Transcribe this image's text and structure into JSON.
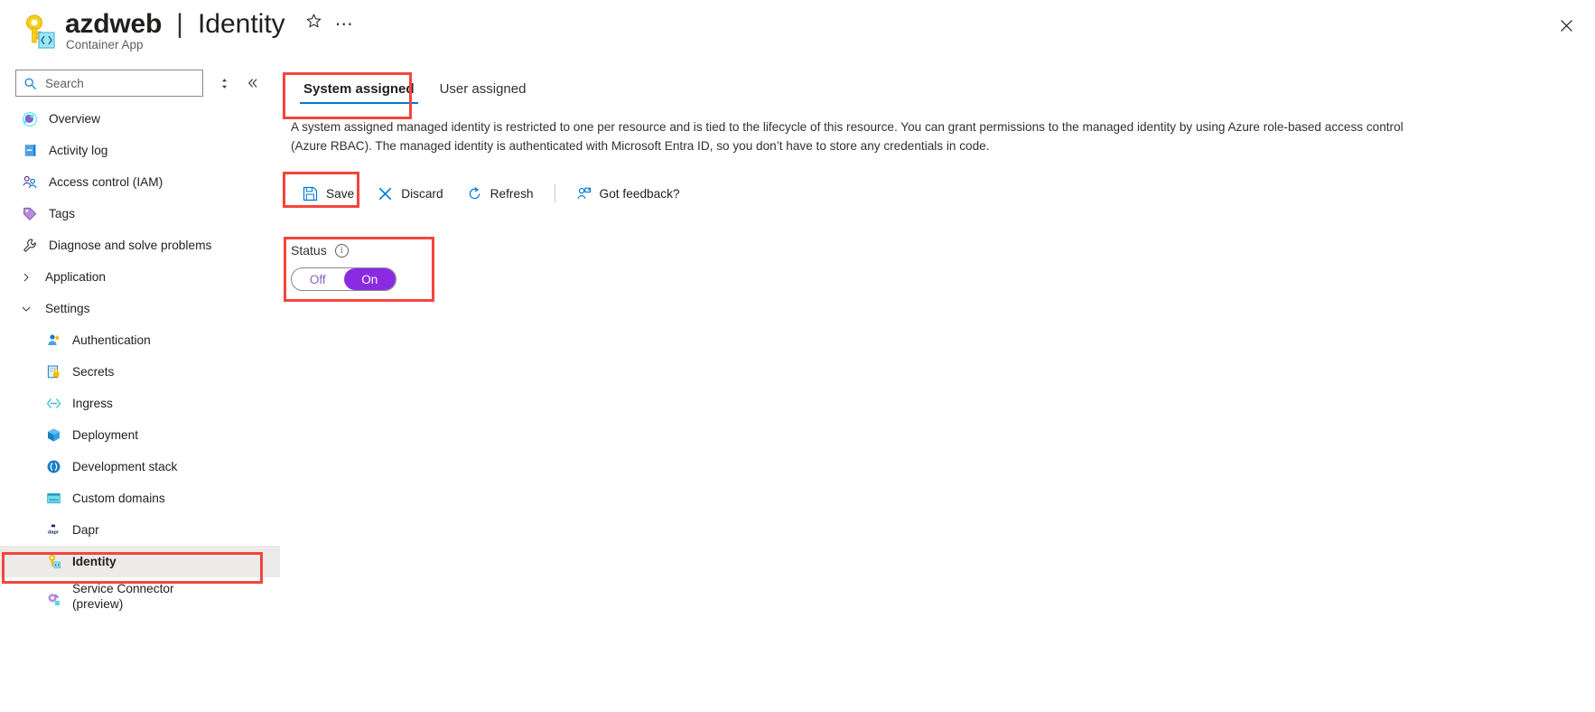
{
  "header": {
    "resource_name": "azdweb",
    "separator": "|",
    "page_name": "Identity",
    "resource_type": "Container App",
    "favorite_icon": "star-icon",
    "more_icon": "ellipsis-icon",
    "close_icon": "close-icon"
  },
  "sidebar": {
    "search": {
      "placeholder": "Search",
      "value": "",
      "icon": "search-icon"
    },
    "sort_icon": "sort-icon",
    "collapse_icon": "double-chevron-left-icon",
    "items": [
      {
        "label": "Overview",
        "icon": "overview-icon",
        "type": "item",
        "selected": false
      },
      {
        "label": "Activity log",
        "icon": "activity-log-icon",
        "type": "item",
        "selected": false
      },
      {
        "label": "Access control (IAM)",
        "icon": "access-control-icon",
        "type": "item",
        "selected": false
      },
      {
        "label": "Tags",
        "icon": "tag-icon",
        "type": "item",
        "selected": false
      },
      {
        "label": "Diagnose and solve problems",
        "icon": "wrench-icon",
        "type": "item",
        "selected": false
      },
      {
        "label": "Application",
        "icon": "chevron-right-icon",
        "type": "group",
        "expanded": false,
        "selected": false
      },
      {
        "label": "Settings",
        "icon": "chevron-down-icon",
        "type": "group",
        "expanded": true,
        "selected": false
      },
      {
        "label": "Authentication",
        "icon": "authentication-icon",
        "type": "child",
        "selected": false
      },
      {
        "label": "Secrets",
        "icon": "secrets-icon",
        "type": "child",
        "selected": false
      },
      {
        "label": "Ingress",
        "icon": "ingress-icon",
        "type": "child",
        "selected": false
      },
      {
        "label": "Deployment",
        "icon": "deployment-icon",
        "type": "child",
        "selected": false
      },
      {
        "label": "Development stack",
        "icon": "dev-stack-icon",
        "type": "child",
        "selected": false
      },
      {
        "label": "Custom domains",
        "icon": "custom-domains-icon",
        "type": "child",
        "selected": false
      },
      {
        "label": "Dapr",
        "icon": "dapr-icon",
        "type": "child",
        "selected": false
      },
      {
        "label": "Identity",
        "icon": "identity-key-icon",
        "type": "child",
        "selected": true
      },
      {
        "label": "Service Connector (preview)",
        "icon": "service-connector-icon",
        "type": "child-twoline",
        "selected": false,
        "line1": "Service Connector",
        "line2": "(preview)"
      }
    ]
  },
  "main": {
    "tabs": [
      {
        "label": "System assigned",
        "active": true
      },
      {
        "label": "User assigned",
        "active": false
      }
    ],
    "description": "A system assigned managed identity is restricted to one per resource and is tied to the lifecycle of this resource. You can grant permissions to the managed identity by using Azure role-based access control (Azure RBAC). The managed identity is authenticated with Microsoft Entra ID, so you don’t have to store any credentials in code.",
    "commands": [
      {
        "label": "Save",
        "icon": "save-icon"
      },
      {
        "label": "Discard",
        "icon": "discard-x-icon"
      },
      {
        "label": "Refresh",
        "icon": "refresh-icon"
      },
      {
        "label": "Got feedback?",
        "icon": "feedback-person-icon"
      }
    ],
    "status": {
      "label": "Status",
      "info_icon": "info-icon",
      "off_label": "Off",
      "on_label": "On",
      "value": "On"
    }
  },
  "colors": {
    "accent_blue": "#0078d4",
    "toggle_on_purple": "#8a2be2",
    "toggle_off_text": "#8764b8",
    "highlight_red": "#f4453c",
    "selected_row_gray": "#edebe9"
  },
  "annotations": [
    {
      "name": "system-assigned-tab-highlight"
    },
    {
      "name": "save-button-highlight"
    },
    {
      "name": "status-toggle-highlight"
    },
    {
      "name": "identity-nav-highlight"
    }
  ]
}
